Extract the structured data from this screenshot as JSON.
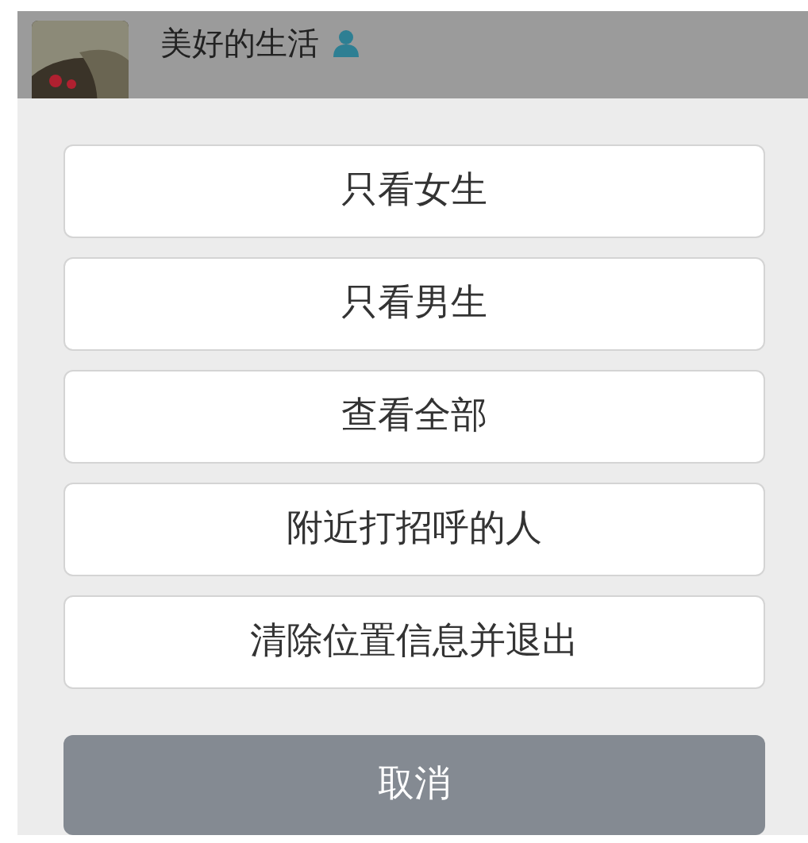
{
  "header": {
    "name": "美好的生活"
  },
  "options": [
    {
      "label": "只看女生"
    },
    {
      "label": "只看男生"
    },
    {
      "label": "查看全部"
    },
    {
      "label": "附近打招呼的人"
    },
    {
      "label": "清除位置信息并退出"
    }
  ],
  "cancel": {
    "label": "取消"
  }
}
